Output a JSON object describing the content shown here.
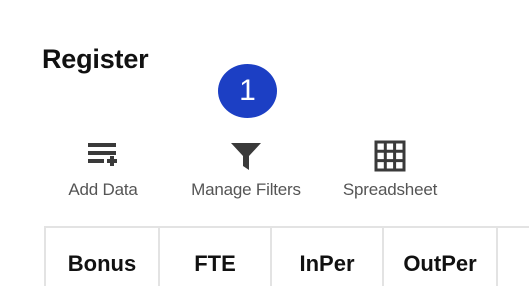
{
  "page": {
    "title": "Register"
  },
  "step_badge": {
    "number": "1"
  },
  "toolbar": {
    "add_data_label": "Add Data",
    "manage_filters_label": "Manage Filters",
    "spreadsheet_label": "Spreadsheet"
  },
  "table": {
    "columns": [
      "Bonus",
      "FTE",
      "InPer",
      "OutPer"
    ]
  },
  "colors": {
    "badge": "#1c3fc4",
    "icon": "#3a3a3a",
    "label": "#555555",
    "grid_line": "#e3e3e3"
  }
}
